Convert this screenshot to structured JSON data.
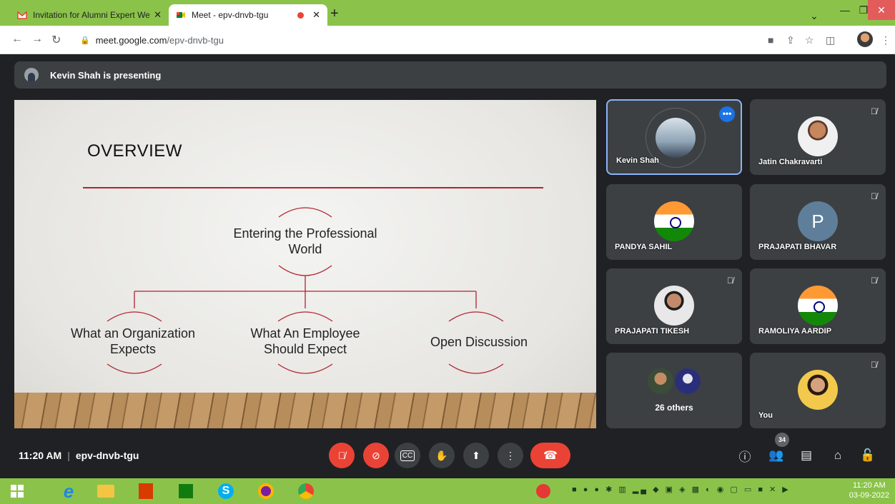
{
  "browser": {
    "tabs": [
      {
        "title": "Invitation for Alumni Expert Web",
        "favicon": "gmail-icon"
      },
      {
        "title": "Meet - epv-dnvb-tgu",
        "favicon": "meet-icon",
        "recording": true
      }
    ],
    "address": {
      "host": "meet.google.com",
      "path": "/epv-dnvb-tgu"
    }
  },
  "meet": {
    "presenting_text": "Kevin Shah is presenting",
    "slide": {
      "title": "OVERVIEW",
      "center_node": "Entering the Professional World",
      "left_node": "What an Organization Expects",
      "middle_node": "What An Employee Should Expect",
      "right_node": "Open Discussion",
      "accent_color": "#b0242f"
    },
    "participants": [
      {
        "name": "Kevin Shah",
        "muted": false,
        "active": true
      },
      {
        "name": "Jatin Chakravarti",
        "muted": true
      },
      {
        "name": "PANDYA SAHIL",
        "muted": false
      },
      {
        "name": "PRAJAPATI BHAVAR",
        "muted": true,
        "initial": "P"
      },
      {
        "name": "PRAJAPATI TIKESH",
        "muted": true
      },
      {
        "name": "RAMOLIYA AARDIP",
        "muted": true
      },
      {
        "name": "26 others"
      },
      {
        "name": "You",
        "muted": true
      }
    ],
    "time": "11:20 AM",
    "meeting_code": "epv-dnvb-tgu",
    "people_count": "34"
  },
  "taskbar": {
    "time": "11:20 AM",
    "date": "03-09-2022"
  }
}
